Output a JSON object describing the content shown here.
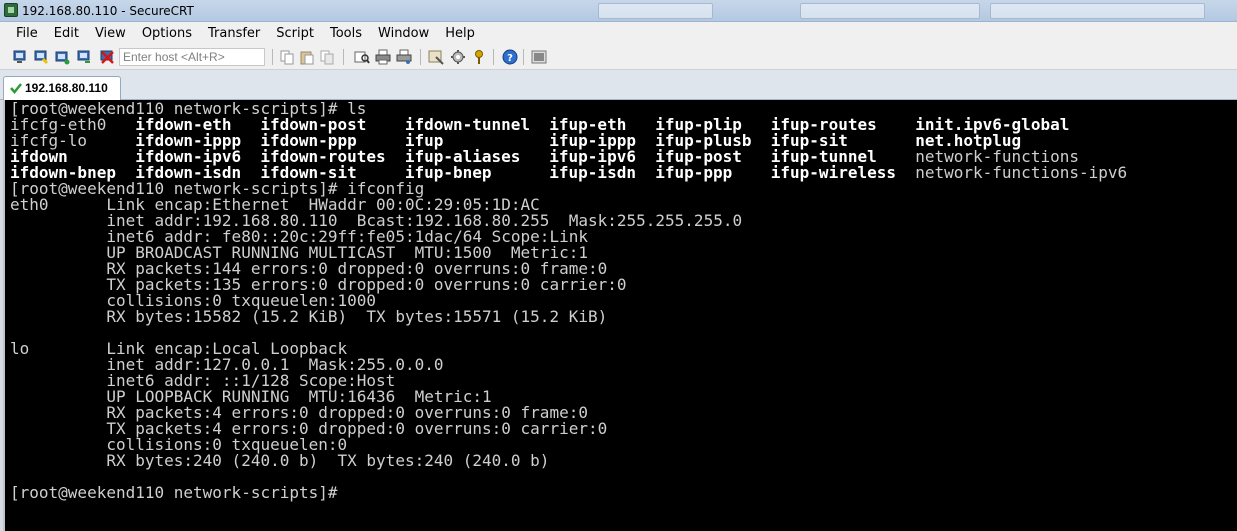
{
  "window": {
    "title": "192.168.80.110 - SecureCRT"
  },
  "menu": [
    "File",
    "Edit",
    "View",
    "Options",
    "Transfer",
    "Script",
    "Tools",
    "Window",
    "Help"
  ],
  "toolbar": {
    "host_placeholder": "Enter host <Alt+R>",
    "icons": [
      "connect-icon",
      "quick-connect-icon",
      "connect-tab-icon",
      "reconnect-icon",
      "disconnect-icon",
      "copy-icon",
      "paste-icon",
      "copy-paste-icon",
      "find-icon",
      "print-icon",
      "print-setup-icon",
      "session-options-icon",
      "global-options-icon",
      "keymap-icon",
      "help-icon",
      "about-icon"
    ]
  },
  "tab": {
    "label": "192.168.80.110",
    "status_color": "#2e9b3a"
  },
  "terminal": {
    "prompt_ls": "[root@weekend110 network-scripts]# ls",
    "ls_columns": [
      [
        "ifcfg-eth0",
        "ifcfg-lo",
        "ifdown",
        "ifdown-bnep"
      ],
      [
        "ifdown-eth",
        "ifdown-ippp",
        "ifdown-ipv6",
        "ifdown-isdn"
      ],
      [
        "ifdown-post",
        "ifdown-ppp",
        "ifdown-routes",
        "ifdown-sit"
      ],
      [
        "ifdown-tunnel",
        "ifup",
        "ifup-aliases",
        "ifup-bnep"
      ],
      [
        "ifup-eth",
        "ifup-ippp",
        "ifup-ipv6",
        "ifup-isdn"
      ],
      [
        "ifup-plip",
        "ifup-plusb",
        "ifup-post",
        "ifup-ppp"
      ],
      [
        "ifup-routes",
        "ifup-sit",
        "ifup-tunnel",
        "ifup-wireless"
      ],
      [
        "init.ipv6-global",
        "net.hotplug",
        "network-functions",
        "network-functions-ipv6"
      ]
    ],
    "ls_plain": [
      "ifcfg-eth0",
      "ifcfg-lo",
      "network-functions",
      "network-functions-ipv6"
    ],
    "prompt_ifconfig": "[root@weekend110 network-scripts]# ifconfig",
    "eth0": [
      "eth0      Link encap:Ethernet  HWaddr 00:0C:29:05:1D:AC",
      "          inet addr:192.168.80.110  Bcast:192.168.80.255  Mask:255.255.255.0",
      "          inet6 addr: fe80::20c:29ff:fe05:1dac/64 Scope:Link",
      "          UP BROADCAST RUNNING MULTICAST  MTU:1500  Metric:1",
      "          RX packets:144 errors:0 dropped:0 overruns:0 frame:0",
      "          TX packets:135 errors:0 dropped:0 overruns:0 carrier:0",
      "          collisions:0 txqueuelen:1000",
      "          RX bytes:15582 (15.2 KiB)  TX bytes:15571 (15.2 KiB)"
    ],
    "lo": [
      "lo        Link encap:Local Loopback",
      "          inet addr:127.0.0.1  Mask:255.0.0.0",
      "          inet6 addr: ::1/128 Scope:Host",
      "          UP LOOPBACK RUNNING  MTU:16436  Metric:1",
      "          RX packets:4 errors:0 dropped:0 overruns:0 frame:0",
      "          TX packets:4 errors:0 dropped:0 overruns:0 carrier:0",
      "          collisions:0 txqueuelen:0",
      "          RX bytes:240 (240.0 b)  TX bytes:240 (240.0 b)"
    ],
    "prompt_final": "[root@weekend110 network-scripts]#"
  }
}
